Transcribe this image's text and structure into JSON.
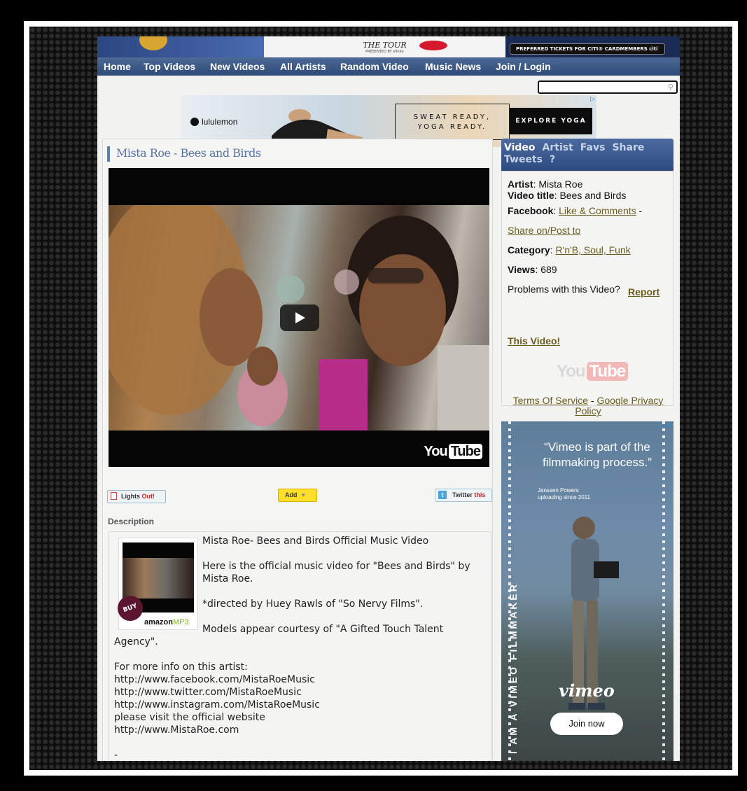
{
  "banner": {
    "tour_text": "THE TOUR",
    "presented_by": "PRESENTED BY xfinity",
    "citi_text": "PREFERRED TICKETS FOR CITI® CARDMEMBERS  citi"
  },
  "nav": {
    "items": [
      "Home",
      "Top Videos",
      "New Videos",
      "All Artists",
      "Random Video",
      "Music News",
      "Join / Login"
    ]
  },
  "search": {
    "value": "",
    "placeholder": ""
  },
  "ad_top": {
    "brand": "lululemon",
    "slogan_line1": "SWEAT READY,",
    "slogan_line2": "YOGA READY.",
    "cta": "EXPLORE YOGA"
  },
  "video": {
    "title": "Mista Roe - Bees and Birds",
    "player_logo_you": "You",
    "player_logo_tube": "Tube"
  },
  "actions": {
    "lights_label": "Lights",
    "lights_out": "Out!",
    "add_label": "Add",
    "twitter_label": "Twitter",
    "twitter_this": "this"
  },
  "description": {
    "heading": "Description",
    "buy": "BUY",
    "amazon": "amazon",
    "mp3": "MP3",
    "lines": [
      "Mista Roe- Bees and Birds Official Music Video",
      "Here is the official music video for \"Bees and Birds\" by Mista Roe.",
      "*directed by Huey Rawls of \"So Nervy Films\".",
      "Models appear courtesy of \"A Gifted Touch Talent Agency\".",
      "For more info on this artist:",
      "http://www.facebook.com/MistaRoeMusic",
      "http://www.twitter.com/MistaRoeMusic",
      "http://www.instagram.com/MistaRoeMusic",
      "please visit the official website",
      "http://www.MistaRoe.com",
      "-"
    ]
  },
  "sidebar": {
    "tabs": [
      "Video",
      "Artist",
      "Favs",
      "Share",
      "Tweets",
      "?"
    ],
    "artist_label": "Artist",
    "artist_value": "Mista Roe",
    "title_label": "Video title",
    "title_value": "Bees and Birds",
    "facebook_label": "Facebook",
    "facebook_link": "Like & Comments",
    "share_link": "Share on/Post to",
    "category_label": "Category",
    "category_value": "R'n'B, Soul, Funk",
    "views_label": "Views",
    "views_value": "689",
    "problems_text": "Problems with this Video?",
    "report_link": "Report This Video!",
    "yt_you": "You",
    "yt_tube": "Tube",
    "tos_link": "Terms Of Service",
    "privacy_link": "Google Privacy Policy"
  },
  "ad_vimeo": {
    "quote": "“Vimeo is part of the filmmaking process.”",
    "author": "Janssen Powers",
    "author_sub": "uploading since 2011",
    "vertical": "I AM A VIMEO FILMMAKER",
    "logo": "vimeo",
    "cta": "Join now"
  },
  "colors": {
    "nav_bg": "#2e4a78",
    "title_blue": "#5773a0",
    "link_olive": "#6b5d1e",
    "add_yellow": "#ffdf29"
  }
}
